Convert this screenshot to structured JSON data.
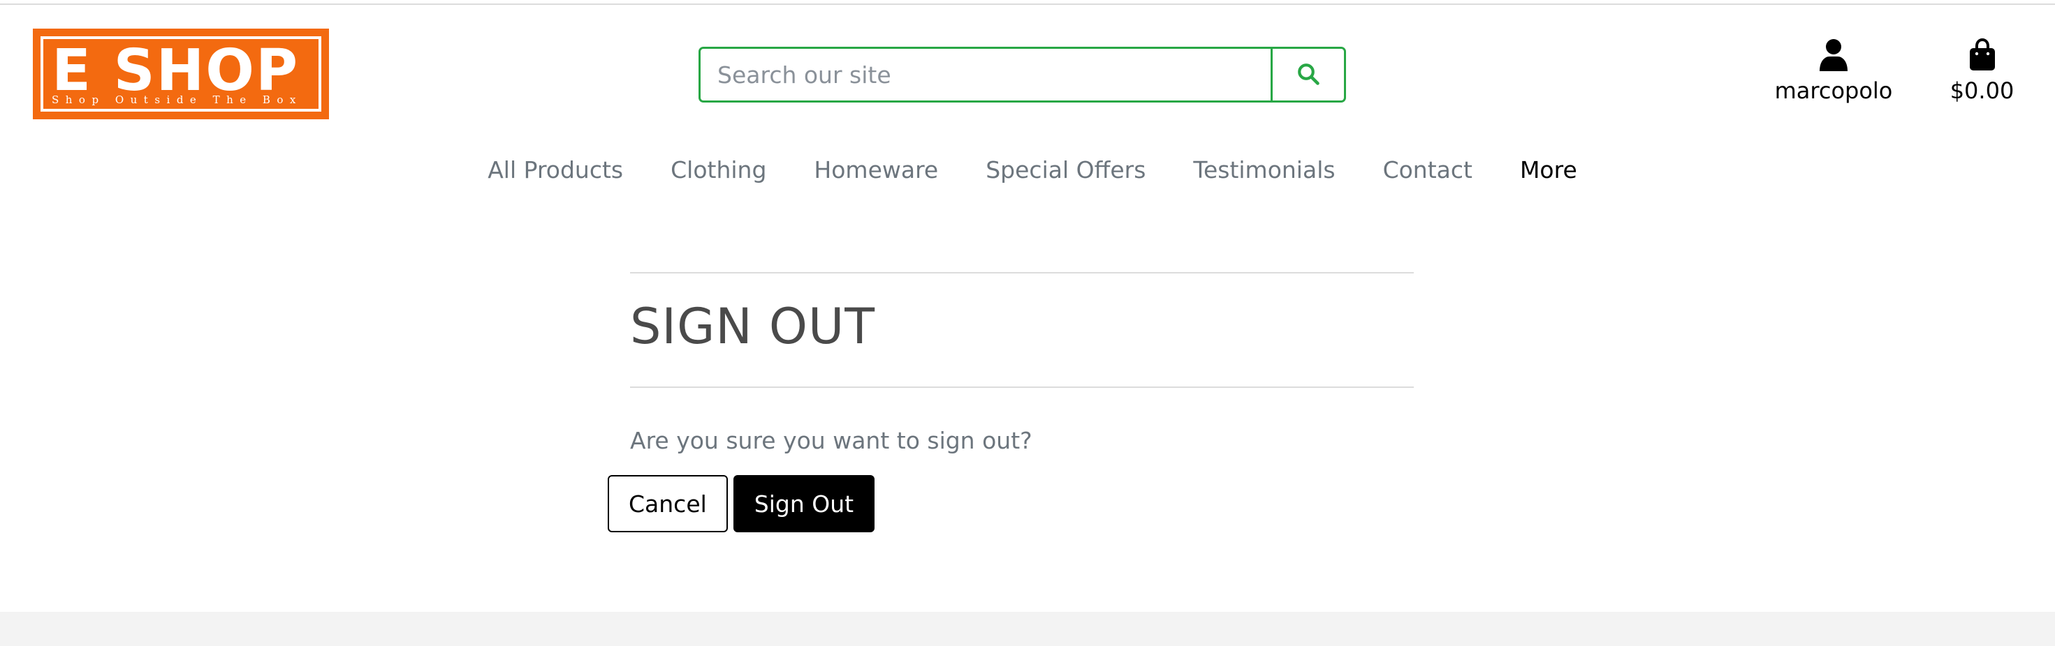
{
  "header": {
    "logo": {
      "title": "E SHOP",
      "tagline": "Shop Outside The Box",
      "color": "#f36a10"
    },
    "search": {
      "placeholder": "Search our site",
      "button_icon": "search-icon",
      "accent": "#28a745"
    },
    "account": {
      "icon": "user-icon",
      "username": "marcopolo"
    },
    "cart": {
      "icon": "shopping-bag-icon",
      "total": "$0.00"
    }
  },
  "nav": {
    "items": [
      {
        "label": "All Products"
      },
      {
        "label": "Clothing"
      },
      {
        "label": "Homeware"
      },
      {
        "label": "Special Offers"
      },
      {
        "label": "Testimonials"
      },
      {
        "label": "Contact"
      },
      {
        "label": "More"
      }
    ]
  },
  "main": {
    "title": "SIGN OUT",
    "question": "Are you sure you want to sign out?",
    "cancel_label": "Cancel",
    "signout_label": "Sign Out"
  }
}
